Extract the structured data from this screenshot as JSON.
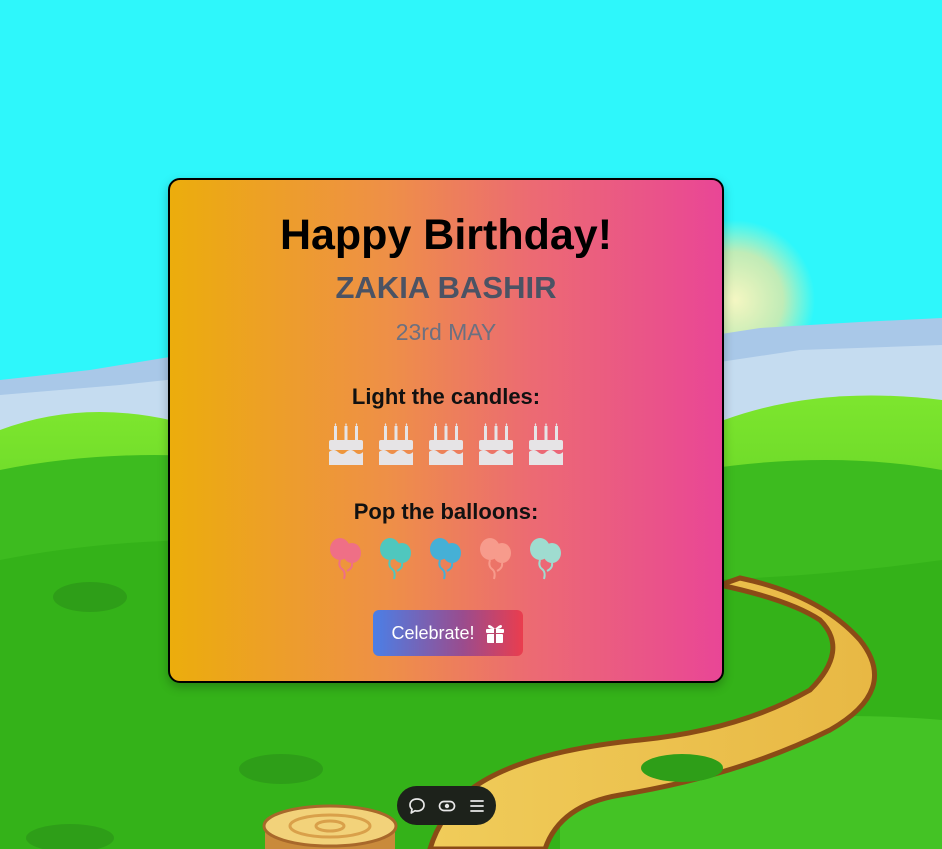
{
  "card": {
    "title": "Happy Birthday!",
    "name": "ZAKIA BASHIR",
    "date": "23rd MAY",
    "candles_label": "Light the candles:",
    "balloons_label": "Pop the balloons:",
    "cakes": [
      {
        "icon": "birthday-cake-icon"
      },
      {
        "icon": "birthday-cake-icon"
      },
      {
        "icon": "birthday-cake-icon"
      },
      {
        "icon": "birthday-cake-icon"
      },
      {
        "icon": "birthday-cake-icon"
      }
    ],
    "balloons": [
      {
        "icon": "balloons-icon",
        "color": "#ef6f86"
      },
      {
        "icon": "balloons-icon",
        "color": "#4fc7be"
      },
      {
        "icon": "balloons-icon",
        "color": "#45b0d6"
      },
      {
        "icon": "balloons-icon",
        "color": "#f79b8c"
      },
      {
        "icon": "balloons-icon",
        "color": "#9fdcd0"
      }
    ],
    "celebrate_label": "Celebrate!",
    "celebrate_icon": "gift-icon"
  },
  "toolbar": {
    "items": [
      {
        "icon": "chat-bubble-icon"
      },
      {
        "icon": "eye-icon"
      },
      {
        "icon": "menu-icon"
      }
    ]
  },
  "colors": {
    "sky": "#2ef7fb",
    "card_gradient_start": "#ecad0c",
    "card_gradient_end": "#e94696",
    "cake": "#e6e4e6",
    "button_gradient_start": "#4b7fe6",
    "button_gradient_end": "#ea3d4e",
    "toolbar_bg": "#1d221b"
  }
}
